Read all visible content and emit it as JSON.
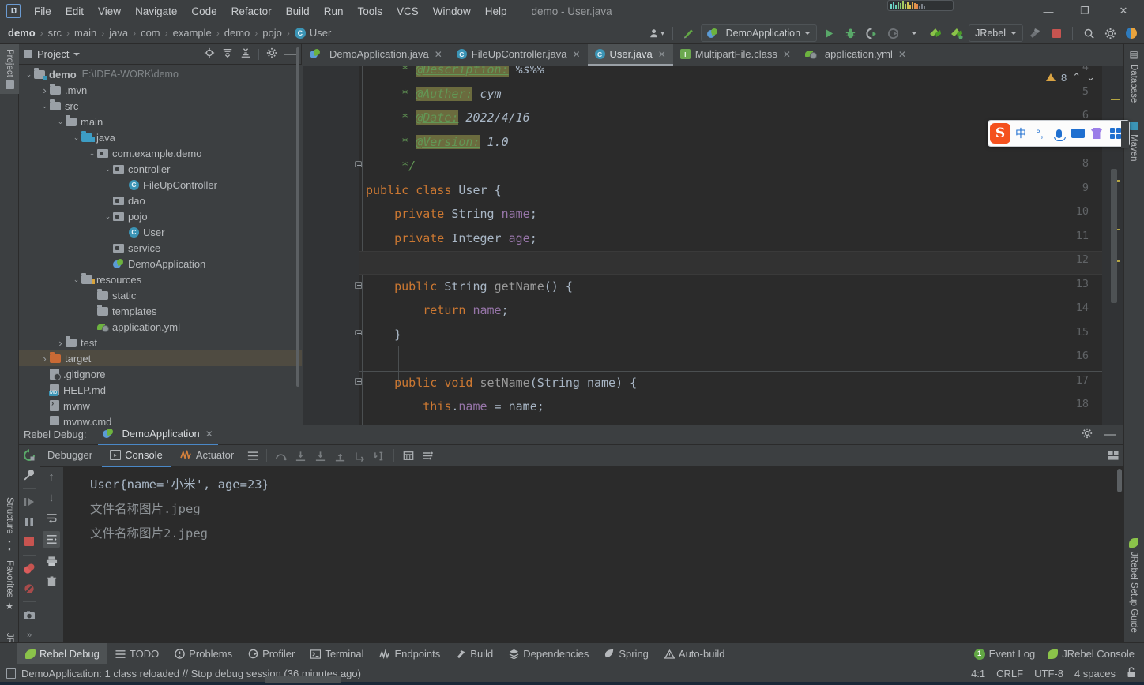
{
  "titlebar": {
    "logo": "IJ",
    "menu": [
      "File",
      "Edit",
      "View",
      "Navigate",
      "Code",
      "Refactor",
      "Build",
      "Run",
      "Tools",
      "VCS",
      "Window",
      "Help"
    ],
    "window_title": "demo - User.java",
    "minimize": "—",
    "maximize": "❐",
    "close": "✕"
  },
  "navbar": {
    "breadcrumbs": [
      "demo",
      "src",
      "main",
      "java",
      "com",
      "example",
      "demo",
      "pojo",
      "User"
    ],
    "class_badge": "C",
    "separator": "›",
    "run_config": "DemoApplication",
    "jrebel_label": "JRebel",
    "icons": {
      "profile": "person-icon",
      "update": "update-project-icon",
      "run": "run-icon",
      "debug": "debug-icon",
      "run_coverage": "run-with-coverage-icon",
      "profiler": "profiler-icon",
      "jrebel_run": "jrebel-run-icon",
      "jrebel_debug": "jrebel-debug-icon",
      "build": "build-hammer-icon",
      "stop": "stop-icon",
      "search": "search-icon",
      "settings": "gear-icon",
      "theme": "theme-toggle-icon"
    }
  },
  "left_strip": [
    {
      "label": "Project",
      "selected": true
    },
    {
      "label": "Structure",
      "selected": false
    },
    {
      "label": "Favorites",
      "selected": false
    },
    {
      "label": "JRebel",
      "selected": false
    }
  ],
  "right_strip": [
    {
      "label": "Database",
      "selected": false
    },
    {
      "label": "Maven",
      "selected": false
    },
    {
      "label": "JRebel Setup Guide",
      "selected": false
    }
  ],
  "project_panel": {
    "title": "Project",
    "header_icons": [
      "locate-icon",
      "expand-all-icon",
      "collapse-all-icon",
      "gear-icon",
      "hide-icon"
    ],
    "tree": [
      {
        "depth": 0,
        "arrow": "v",
        "icon": "module",
        "label": "demo",
        "suffix": "E:\\IDEA-WORK\\demo",
        "bold": true
      },
      {
        "depth": 1,
        "arrow": ">",
        "icon": "folder",
        "label": ".mvn"
      },
      {
        "depth": 1,
        "arrow": "v",
        "icon": "folder",
        "label": "src"
      },
      {
        "depth": 2,
        "arrow": "v",
        "icon": "folder",
        "label": "main"
      },
      {
        "depth": 3,
        "arrow": "v",
        "icon": "folder-blue",
        "label": "java"
      },
      {
        "depth": 4,
        "arrow": "v",
        "icon": "package",
        "label": "com.example.demo"
      },
      {
        "depth": 5,
        "arrow": "v",
        "icon": "package",
        "label": "controller"
      },
      {
        "depth": 6,
        "arrow": "",
        "icon": "class",
        "label": "FileUpController"
      },
      {
        "depth": 5,
        "arrow": "",
        "icon": "package",
        "label": "dao"
      },
      {
        "depth": 5,
        "arrow": "v",
        "icon": "package",
        "label": "pojo"
      },
      {
        "depth": 6,
        "arrow": "",
        "icon": "class",
        "label": "User"
      },
      {
        "depth": 5,
        "arrow": "",
        "icon": "package",
        "label": "service"
      },
      {
        "depth": 5,
        "arrow": "",
        "icon": "spring",
        "label": "DemoApplication"
      },
      {
        "depth": 3,
        "arrow": "v",
        "icon": "folder-res",
        "label": "resources"
      },
      {
        "depth": 4,
        "arrow": "",
        "icon": "folder",
        "label": "static"
      },
      {
        "depth": 4,
        "arrow": "",
        "icon": "folder",
        "label": "templates"
      },
      {
        "depth": 4,
        "arrow": "",
        "icon": "yml",
        "label": "application.yml"
      },
      {
        "depth": 2,
        "arrow": ">",
        "icon": "folder",
        "label": "test"
      },
      {
        "depth": 1,
        "arrow": ">",
        "icon": "folder-orange",
        "label": "target",
        "selected": true
      },
      {
        "depth": 1,
        "arrow": "",
        "icon": "gitignore",
        "label": ".gitignore"
      },
      {
        "depth": 1,
        "arrow": "",
        "icon": "md",
        "label": "HELP.md"
      },
      {
        "depth": 1,
        "arrow": "",
        "icon": "sh",
        "label": "mvnw"
      },
      {
        "depth": 1,
        "arrow": "",
        "icon": "cmd",
        "label": "mvnw.cmd"
      }
    ]
  },
  "editor": {
    "tabs": [
      {
        "label": "DemoApplication.java",
        "icon": "spring-class-icon",
        "selected": false
      },
      {
        "label": "FileUpController.java",
        "icon": "class-icon",
        "selected": false
      },
      {
        "label": "User.java",
        "icon": "class-icon",
        "selected": true
      },
      {
        "label": "MultipartFile.class",
        "icon": "interface-icon",
        "selected": false
      },
      {
        "label": "application.yml",
        "icon": "yml-icon",
        "selected": false
      }
    ],
    "close_glyph": "✕",
    "warning_count": "8",
    "warning_icon": "warning-triangle-icon",
    "nav_up": "⌃",
    "nav_down": "⌄",
    "first_visible_line": 4,
    "current_line": 12,
    "lines": [
      {
        "n": 4,
        "segs": [
          {
            "t": "     * ",
            "c": "c-com"
          },
          {
            "t": "@Description:",
            "c": "c-tag"
          },
          {
            "t": " %s%%",
            "c": "c-comv"
          }
        ]
      },
      {
        "n": 5,
        "segs": [
          {
            "t": "     * ",
            "c": "c-com"
          },
          {
            "t": "@Auther:",
            "c": "c-tag"
          },
          {
            "t": " cym",
            "c": "c-comv"
          }
        ]
      },
      {
        "n": 6,
        "segs": [
          {
            "t": "     * ",
            "c": "c-com"
          },
          {
            "t": "@Date:",
            "c": "c-tag"
          },
          {
            "t": " 2022/4/16",
            "c": "c-comv"
          }
        ]
      },
      {
        "n": 7,
        "segs": [
          {
            "t": "     * ",
            "c": "c-com"
          },
          {
            "t": "@Version:",
            "c": "c-tag"
          },
          {
            "t": " 1.0",
            "c": "c-comv"
          }
        ]
      },
      {
        "n": 8,
        "segs": [
          {
            "t": "     */",
            "c": "c-com"
          }
        ]
      },
      {
        "n": 9,
        "segs": [
          {
            "t": "public class ",
            "c": "c-kw"
          },
          {
            "t": "User ",
            "c": "c-type"
          },
          {
            "t": "{",
            "c": "c-def"
          }
        ]
      },
      {
        "n": 10,
        "segs": [
          {
            "t": "    private ",
            "c": "c-kw"
          },
          {
            "t": "String ",
            "c": "c-type"
          },
          {
            "t": "name",
            "c": "c-fld"
          },
          {
            "t": ";",
            "c": "c-def"
          }
        ]
      },
      {
        "n": 11,
        "segs": [
          {
            "t": "    private ",
            "c": "c-kw"
          },
          {
            "t": "Integer ",
            "c": "c-type"
          },
          {
            "t": "age",
            "c": "c-fld"
          },
          {
            "t": ";",
            "c": "c-def"
          }
        ]
      },
      {
        "n": 12,
        "segs": [
          {
            "t": "",
            "c": "c-def"
          }
        ]
      },
      {
        "n": 13,
        "segs": [
          {
            "t": "    public ",
            "c": "c-kw"
          },
          {
            "t": "String ",
            "c": "c-type"
          },
          {
            "t": "getName",
            "c": "c-meth"
          },
          {
            "t": "() {",
            "c": "c-def"
          }
        ]
      },
      {
        "n": 14,
        "segs": [
          {
            "t": "        return ",
            "c": "c-kw"
          },
          {
            "t": "name",
            "c": "c-fld"
          },
          {
            "t": ";",
            "c": "c-def"
          }
        ]
      },
      {
        "n": 15,
        "segs": [
          {
            "t": "    }",
            "c": "c-def"
          }
        ]
      },
      {
        "n": 16,
        "segs": [
          {
            "t": "",
            "c": "c-def"
          }
        ]
      },
      {
        "n": 17,
        "segs": [
          {
            "t": "    public void ",
            "c": "c-kw"
          },
          {
            "t": "setName",
            "c": "c-meth"
          },
          {
            "t": "(",
            "c": "c-def"
          },
          {
            "t": "String",
            "c": "c-type"
          },
          {
            "t": " name) {",
            "c": "c-def"
          }
        ]
      },
      {
        "n": 18,
        "segs": [
          {
            "t": "        this",
            "c": "c-kw"
          },
          {
            "t": ".",
            "c": "c-def"
          },
          {
            "t": "name",
            "c": "c-fld"
          },
          {
            "t": " = name;",
            "c": "c-def"
          }
        ]
      }
    ]
  },
  "debug_panel": {
    "title": "Rebel Debug:",
    "session_tab": "DemoApplication",
    "session_close": "✕",
    "header_icons": [
      "gear-icon",
      "hide-icon"
    ],
    "tabs": [
      {
        "label": "Debugger",
        "icon": "debugger-icon",
        "selected": false
      },
      {
        "label": "Console",
        "icon": "console-icon",
        "selected": true
      },
      {
        "label": "Actuator",
        "icon": "actuator-icon",
        "selected": false
      }
    ],
    "toolbar_icons": [
      "show-list-icon",
      "step-over-icon",
      "step-into-icon",
      "force-step-into-icon",
      "step-out-icon",
      "drop-frame-icon",
      "run-to-cursor-icon",
      "evaluate-icon",
      "settings-icon"
    ],
    "left_icons": [
      "rerun-icon",
      "wrench-icon",
      "resume-icon",
      "pause-icon",
      "stop-icon",
      "breakpoints-icon",
      "mute-breakpoints-icon",
      "camera-icon",
      "more-icon"
    ],
    "side_icons": [
      "scroll-up-icon",
      "scroll-down-icon",
      "soft-wrap-icon",
      "scroll-to-end-icon",
      "print-icon",
      "trash-icon"
    ],
    "console_lines": [
      {
        "text": "User{name='小米', age=23}",
        "dim": false
      },
      {
        "text": "文件名称图片.jpeg",
        "dim": true
      },
      {
        "text": "文件名称图片2.jpeg",
        "dim": true
      }
    ]
  },
  "statusbar": {
    "items": [
      {
        "label": "Rebel Debug",
        "icon": "jrebel-icon",
        "selected": true
      },
      {
        "label": "TODO",
        "icon": "todo-icon",
        "selected": false
      },
      {
        "label": "Problems",
        "icon": "problems-icon",
        "selected": false
      },
      {
        "label": "Profiler",
        "icon": "profiler-icon",
        "selected": false
      },
      {
        "label": "Terminal",
        "icon": "terminal-icon",
        "selected": false
      },
      {
        "label": "Endpoints",
        "icon": "endpoints-icon",
        "selected": false
      },
      {
        "label": "Build",
        "icon": "build-icon",
        "selected": false
      },
      {
        "label": "Dependencies",
        "icon": "dependencies-icon",
        "selected": false
      },
      {
        "label": "Spring",
        "icon": "spring-icon",
        "selected": false
      },
      {
        "label": "Auto-build",
        "icon": "autobuild-icon",
        "selected": false
      }
    ],
    "event_log": "Event Log",
    "event_log_count": "1",
    "jrebel_console": "JRebel Console",
    "message": "DemoApplication: 1 class reloaded // Stop debug session (36 minutes ago)",
    "caret_position": "4:1",
    "line_separator": "CRLF",
    "encoding": "UTF-8",
    "indent": "4 spaces",
    "lock_icon": "unlocked-icon"
  },
  "ime": {
    "name": "sogou-input-toolbar",
    "logo": "S",
    "mode": "中",
    "punct": "°,",
    "buttons": [
      "mic-icon",
      "keyboard-icon",
      "skin-icon",
      "apps-icon"
    ]
  },
  "colors": {
    "chrome": "#3c3f41",
    "editor_bg": "#2b2b2b",
    "gutter_bg": "#313335",
    "accent": "#4a88c7",
    "selection": "#4f4b41",
    "keyword": "#cc7832",
    "field": "#9876aa",
    "comment": "#629755",
    "warning": "#d9a343"
  }
}
